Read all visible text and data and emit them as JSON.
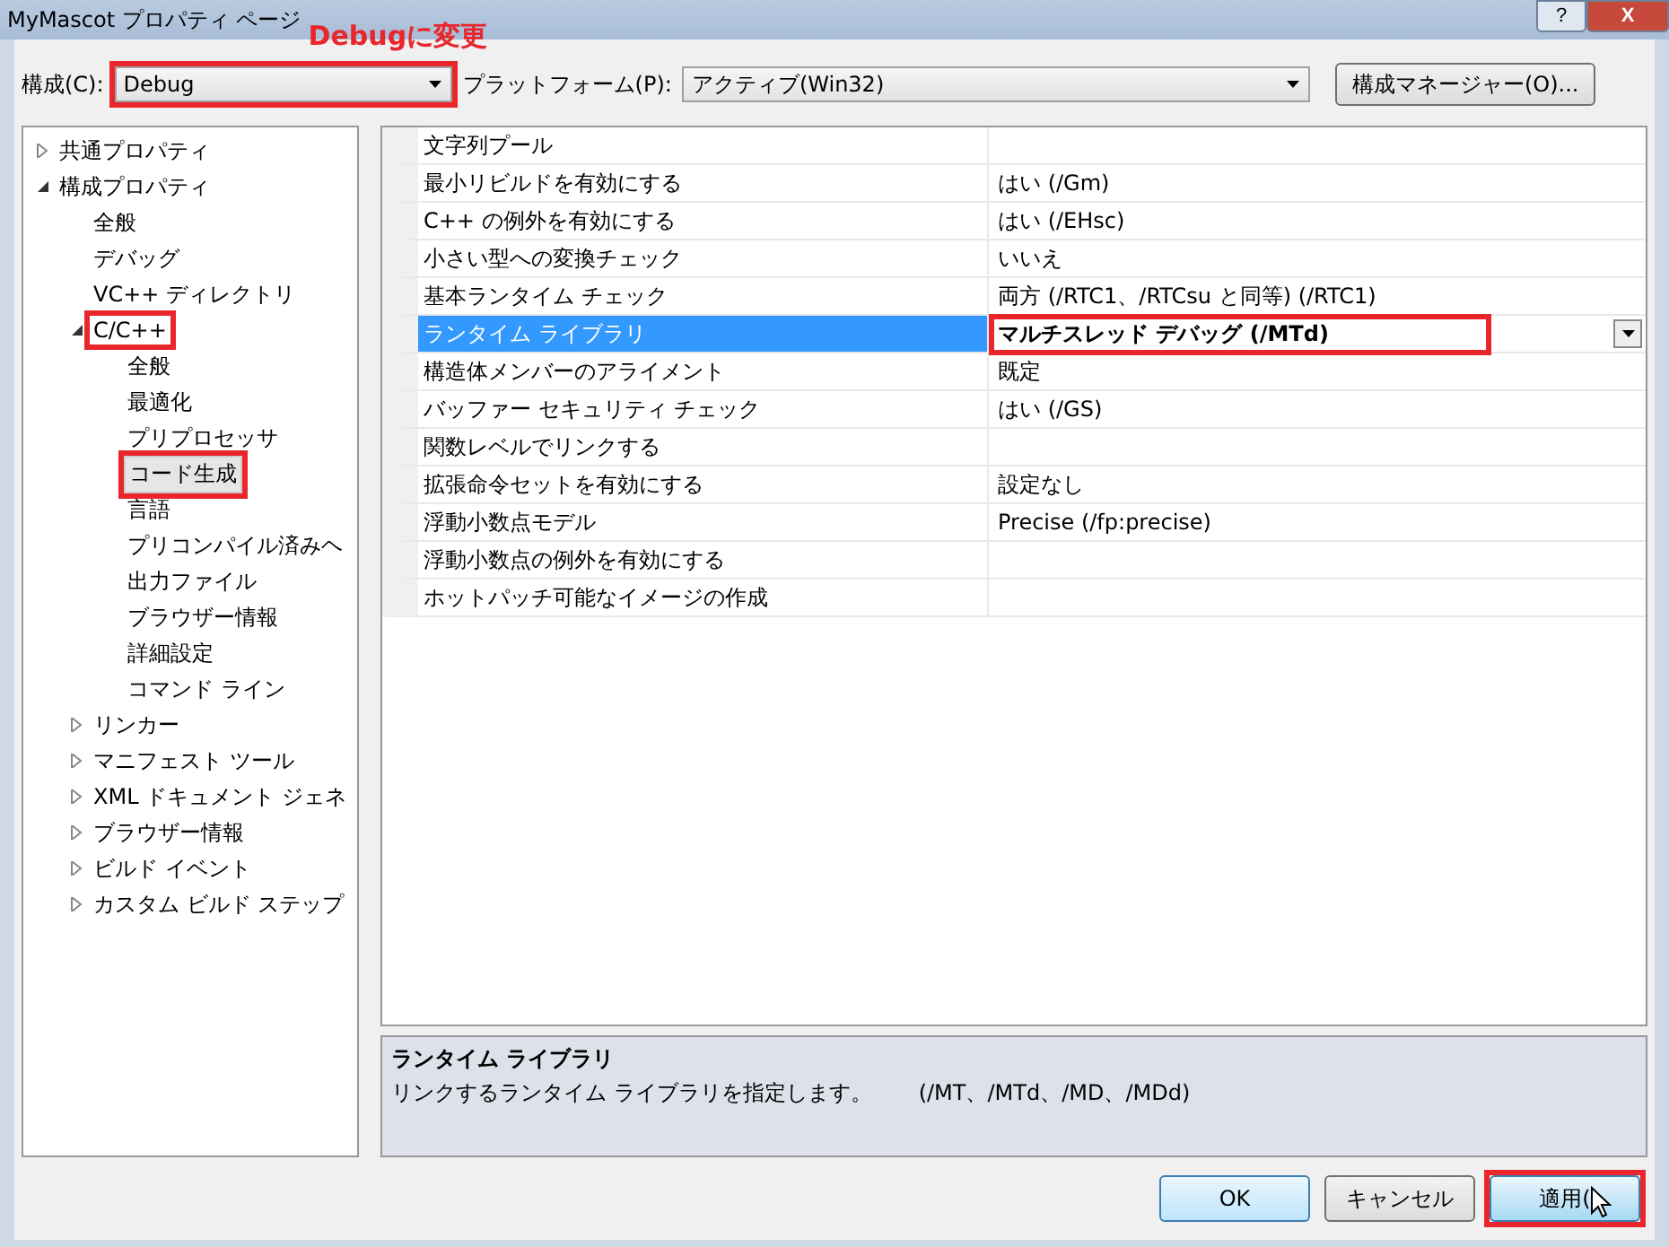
{
  "window": {
    "title": "MyMascot プロパティ ページ",
    "buttons": [
      "?",
      "X"
    ]
  },
  "annotation": "Debugに変更",
  "configuration": {
    "label": "構成(C):",
    "value": "Debug",
    "highlighted": true
  },
  "platform": {
    "label": "プラットフォーム(P):",
    "value": "アクティブ(Win32)"
  },
  "config_manager_button": "構成マネージャー(O)...",
  "tree": [
    {
      "label": "共通プロパティ",
      "expanded": false,
      "selected": false,
      "highlighted": false
    },
    {
      "label": "構成プロパティ",
      "expanded": true,
      "selected": false,
      "highlighted": false,
      "children": [
        {
          "label": "全般",
          "selected": false,
          "highlighted": false
        },
        {
          "label": "デバッグ",
          "selected": false,
          "highlighted": false
        },
        {
          "label": "VC++ ディレクトリ",
          "selected": false,
          "highlighted": false
        },
        {
          "label": "C/C++",
          "expanded": true,
          "selected": false,
          "highlighted": true,
          "children": [
            {
              "label": "全般",
              "selected": false,
              "highlighted": false
            },
            {
              "label": "最適化",
              "selected": false,
              "highlighted": false
            },
            {
              "label": "プリプロセッサ",
              "selected": false,
              "highlighted": false
            },
            {
              "label": "コード生成",
              "selected": true,
              "highlighted": true
            },
            {
              "label": "言語",
              "selected": false,
              "highlighted": false
            },
            {
              "label": "プリコンパイル済みヘ",
              "selected": false,
              "highlighted": false
            },
            {
              "label": "出力ファイル",
              "selected": false,
              "highlighted": false
            },
            {
              "label": "ブラウザー情報",
              "selected": false,
              "highlighted": false
            },
            {
              "label": "詳細設定",
              "selected": false,
              "highlighted": false
            },
            {
              "label": "コマンド ライン",
              "selected": false,
              "highlighted": false
            }
          ]
        },
        {
          "label": "リンカー",
          "expanded": false,
          "selected": false,
          "highlighted": false
        },
        {
          "label": "マニフェスト ツール",
          "expanded": false,
          "selected": false,
          "highlighted": false
        },
        {
          "label": "XML ドキュメント ジェネ",
          "expanded": false,
          "selected": false,
          "highlighted": false
        },
        {
          "label": "ブラウザー情報",
          "expanded": false,
          "selected": false,
          "highlighted": false
        },
        {
          "label": "ビルド イベント",
          "expanded": false,
          "selected": false,
          "highlighted": false
        },
        {
          "label": "カスタム ビルド ステップ",
          "expanded": false,
          "selected": false,
          "highlighted": false
        }
      ]
    }
  ],
  "properties": [
    {
      "name": "文字列プール",
      "selected": false
    },
    {
      "name": "最小リビルドを有効にする",
      "value": "はい (/Gm)",
      "selected": false
    },
    {
      "name": "C++ の例外を有効にする",
      "value": "はい (/EHsc)",
      "selected": false
    },
    {
      "name": "小さい型への変換チェック",
      "value": "いいえ",
      "selected": false
    },
    {
      "name": "基本ランタイム チェック",
      "value": "両方 (/RTC1、/RTCsu と同等) (/RTC1)",
      "selected": false
    },
    {
      "name": "ランタイム ライブラリ",
      "value": "マルチスレッド デバッグ (/MTd)",
      "selected": true,
      "highlighted": true
    },
    {
      "name": "構造体メンバーのアライメント",
      "value": "既定",
      "selected": false
    },
    {
      "name": "バッファー セキュリティ チェック",
      "value": "はい (/GS)",
      "selected": false
    },
    {
      "name": "関数レベルでリンクする",
      "selected": false
    },
    {
      "name": "拡張命令セットを有効にする",
      "value": "設定なし",
      "selected": false
    },
    {
      "name": "浮動小数点モデル",
      "value": "Precise (/fp:precise)",
      "selected": false
    },
    {
      "name": "浮動小数点の例外を有効にする",
      "selected": false
    },
    {
      "name": "ホットパッチ可能なイメージの作成",
      "selected": false
    }
  ],
  "description": {
    "title": "ランタイム ライブラリ",
    "text": "リンクするランタイム ライブラリを指定します。",
    "options": "(/MT、/MTd、/MD、/MDd)"
  },
  "buttons": [
    {
      "label": "OK",
      "kind": "default",
      "highlighted": false
    },
    {
      "label": "キャンセル",
      "kind": "normal",
      "highlighted": false
    },
    {
      "label": "適用(",
      "kind": "normal",
      "highlighted": true
    }
  ]
}
